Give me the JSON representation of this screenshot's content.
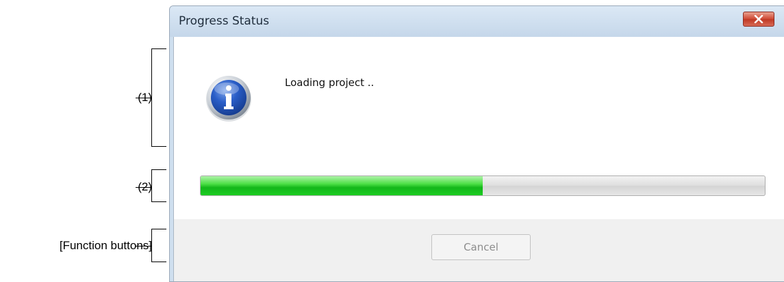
{
  "annotations": {
    "area1": "(1)",
    "area2": "(2)",
    "function_buttons": "[Function buttons]"
  },
  "window": {
    "title": "Progress Status",
    "close_icon": "close-x-icon"
  },
  "message_area": {
    "icon": "information-icon",
    "text": "Loading project .."
  },
  "progress": {
    "percent": 50,
    "fill_color": "#1fc722"
  },
  "buttons": {
    "cancel_label": "Cancel",
    "cancel_enabled": false
  }
}
